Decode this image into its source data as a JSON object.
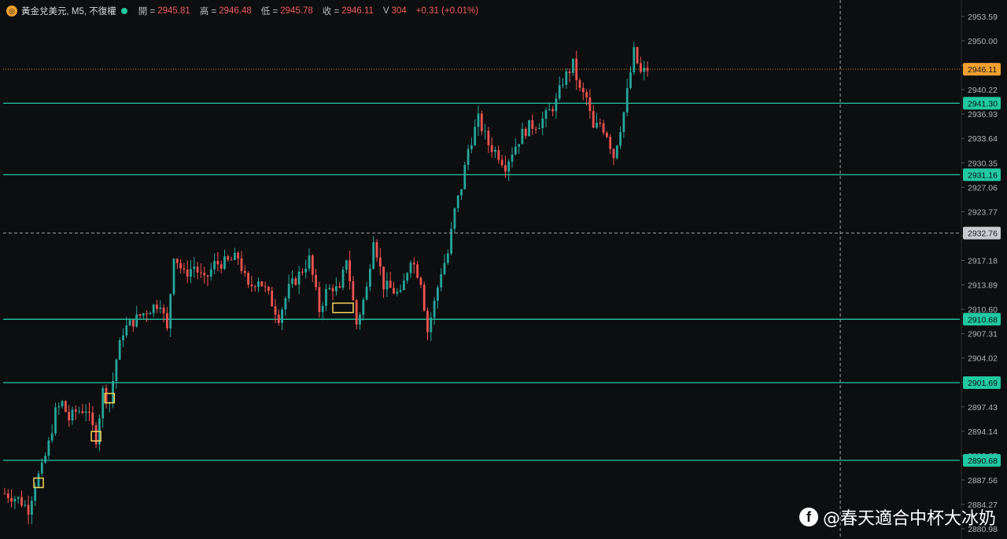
{
  "legend": {
    "symbol": "黃金兌美元, M5, 不復權",
    "open_label": "開 =",
    "open": "2945.81",
    "high_label": "高 =",
    "high": "2946.48",
    "low_label": "低 =",
    "low": "2945.78",
    "close_label": "收 =",
    "close": "2946.11",
    "volume_label": "V",
    "volume": "304",
    "change": "+0.31 (+0.01%)"
  },
  "watermark": {
    "text": "@春天適合中杯大冰奶"
  },
  "colors": {
    "background": "#0d0e10",
    "up": "#26a69a",
    "down": "#ef5350",
    "level_line": "#20c9a2",
    "current_price": "#f0a030",
    "crosshair": "#9aa0a6",
    "highlight_box": "#f2d35b"
  },
  "icons": {
    "symbol_logo": "gold-coin-icon",
    "watermark_logo": "facebook-icon",
    "status_dot": "market-open-dot-icon"
  },
  "chart_data": {
    "type": "candlestick",
    "timeframe": "M5",
    "ylim": [
      2880.0,
      2955.0
    ],
    "y_ticks": [
      "2953.59",
      "2950.00",
      "2943.51",
      "2940.22",
      "2936.93",
      "2933.64",
      "2930.35",
      "2927.06",
      "2923.77",
      "2920.47",
      "2917.18",
      "2913.89",
      "2910.60",
      "2907.31",
      "2904.02",
      "2900.72",
      "2897.43",
      "2894.14",
      "2890.85",
      "2887.56",
      "2884.27",
      "2880.98"
    ],
    "price_levels": [
      {
        "label": "2941.30",
        "value": 2941.3
      },
      {
        "label": "2931.16",
        "value": 2931.16
      },
      {
        "label": "2910.68",
        "value": 2910.68
      },
      {
        "label": "2901.69",
        "value": 2901.69
      },
      {
        "label": "2890.68",
        "value": 2890.68
      }
    ],
    "current_price": {
      "label": "2946.11",
      "value": 2946.11
    },
    "crosshair": {
      "label": "2932.76",
      "value": 2922.9,
      "x_index": 247
    },
    "close_path": [
      [
        0,
        2886.0
      ],
      [
        4,
        2885.2
      ],
      [
        7,
        2883.8
      ],
      [
        9,
        2887.5
      ],
      [
        11,
        2889.5
      ],
      [
        13,
        2893.0
      ],
      [
        15,
        2897.5
      ],
      [
        17,
        2898.8
      ],
      [
        19,
        2896.5
      ],
      [
        21,
        2897.6
      ],
      [
        24,
        2898.0
      ],
      [
        27,
        2893.8
      ],
      [
        29,
        2900.5
      ],
      [
        31,
        2899.0
      ],
      [
        33,
        2905.0
      ],
      [
        35,
        2909.0
      ],
      [
        37,
        2910.0
      ],
      [
        40,
        2911.2
      ],
      [
        43,
        2912.2
      ],
      [
        46,
        2913.2
      ],
      [
        48,
        2909.0
      ],
      [
        50,
        2920.0
      ],
      [
        53,
        2917.0
      ],
      [
        56,
        2918.2
      ],
      [
        59,
        2916.0
      ],
      [
        62,
        2918.5
      ],
      [
        66,
        2918.8
      ],
      [
        69,
        2919.5
      ],
      [
        72,
        2915.0
      ],
      [
        75,
        2916.5
      ],
      [
        78,
        2914.0
      ],
      [
        81,
        2911.0
      ],
      [
        84,
        2915.0
      ],
      [
        87,
        2917.0
      ],
      [
        90,
        2919.2
      ],
      [
        93,
        2912.0
      ],
      [
        95,
        2914.5
      ],
      [
        97,
        2915.3
      ],
      [
        99,
        2914.5
      ],
      [
        101,
        2919.5
      ],
      [
        104,
        2910.0
      ],
      [
        107,
        2915.0
      ],
      [
        109,
        2922.5
      ],
      [
        112,
        2915.5
      ],
      [
        114,
        2915.0
      ],
      [
        117,
        2914.0
      ],
      [
        120,
        2919.5
      ],
      [
        123,
        2916.2
      ],
      [
        125,
        2909.0
      ],
      [
        127,
        2913.0
      ],
      [
        129,
        2917.5
      ],
      [
        131,
        2920.0
      ],
      [
        133,
        2926.0
      ],
      [
        135,
        2929.5
      ],
      [
        137,
        2934.8
      ],
      [
        140,
        2939.0
      ],
      [
        143,
        2935.5
      ],
      [
        146,
        2934.0
      ],
      [
        148,
        2932.5
      ],
      [
        150,
        2934.5
      ],
      [
        153,
        2937.0
      ],
      [
        155,
        2938.0
      ],
      [
        158,
        2938.5
      ],
      [
        160,
        2939.5
      ],
      [
        163,
        2941.5
      ],
      [
        165,
        2944.5
      ],
      [
        168,
        2946.8
      ],
      [
        170,
        2943.0
      ],
      [
        172,
        2942.0
      ],
      [
        174,
        2937.5
      ],
      [
        176,
        2938.5
      ],
      [
        178,
        2937.0
      ],
      [
        180,
        2933.8
      ],
      [
        183,
        2940.0
      ],
      [
        186,
        2948.5
      ],
      [
        188,
        2945.5
      ],
      [
        190,
        2946.11
      ]
    ],
    "highlight_boxes": [
      {
        "x_index": 10,
        "value": 2887.5
      },
      {
        "x_index": 27,
        "value": 2894.1
      },
      {
        "x_index": 31,
        "value": 2899.5
      },
      {
        "x_index": 100,
        "value": 2912.3
      }
    ]
  }
}
